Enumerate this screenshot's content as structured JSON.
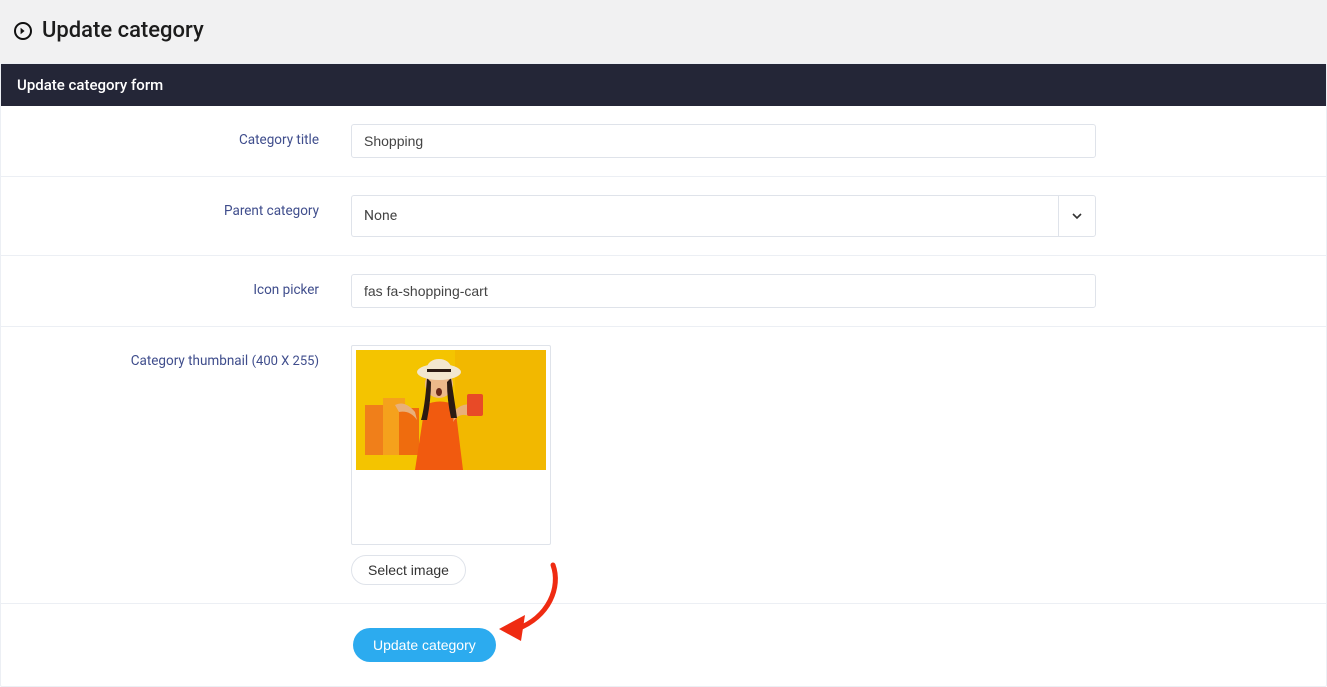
{
  "page": {
    "title": "Update category"
  },
  "panel": {
    "title": "Update category form"
  },
  "form": {
    "category_title_label": "Category title",
    "category_title_value": "Shopping",
    "parent_category_label": "Parent category",
    "parent_category_value": "None",
    "icon_picker_label": "Icon picker",
    "icon_picker_value": "fas fa-shopping-cart",
    "thumbnail_label": "Category thumbnail",
    "thumbnail_dims": "(400 X 255)",
    "select_image_label": "Select image",
    "submit_label": "Update category"
  }
}
